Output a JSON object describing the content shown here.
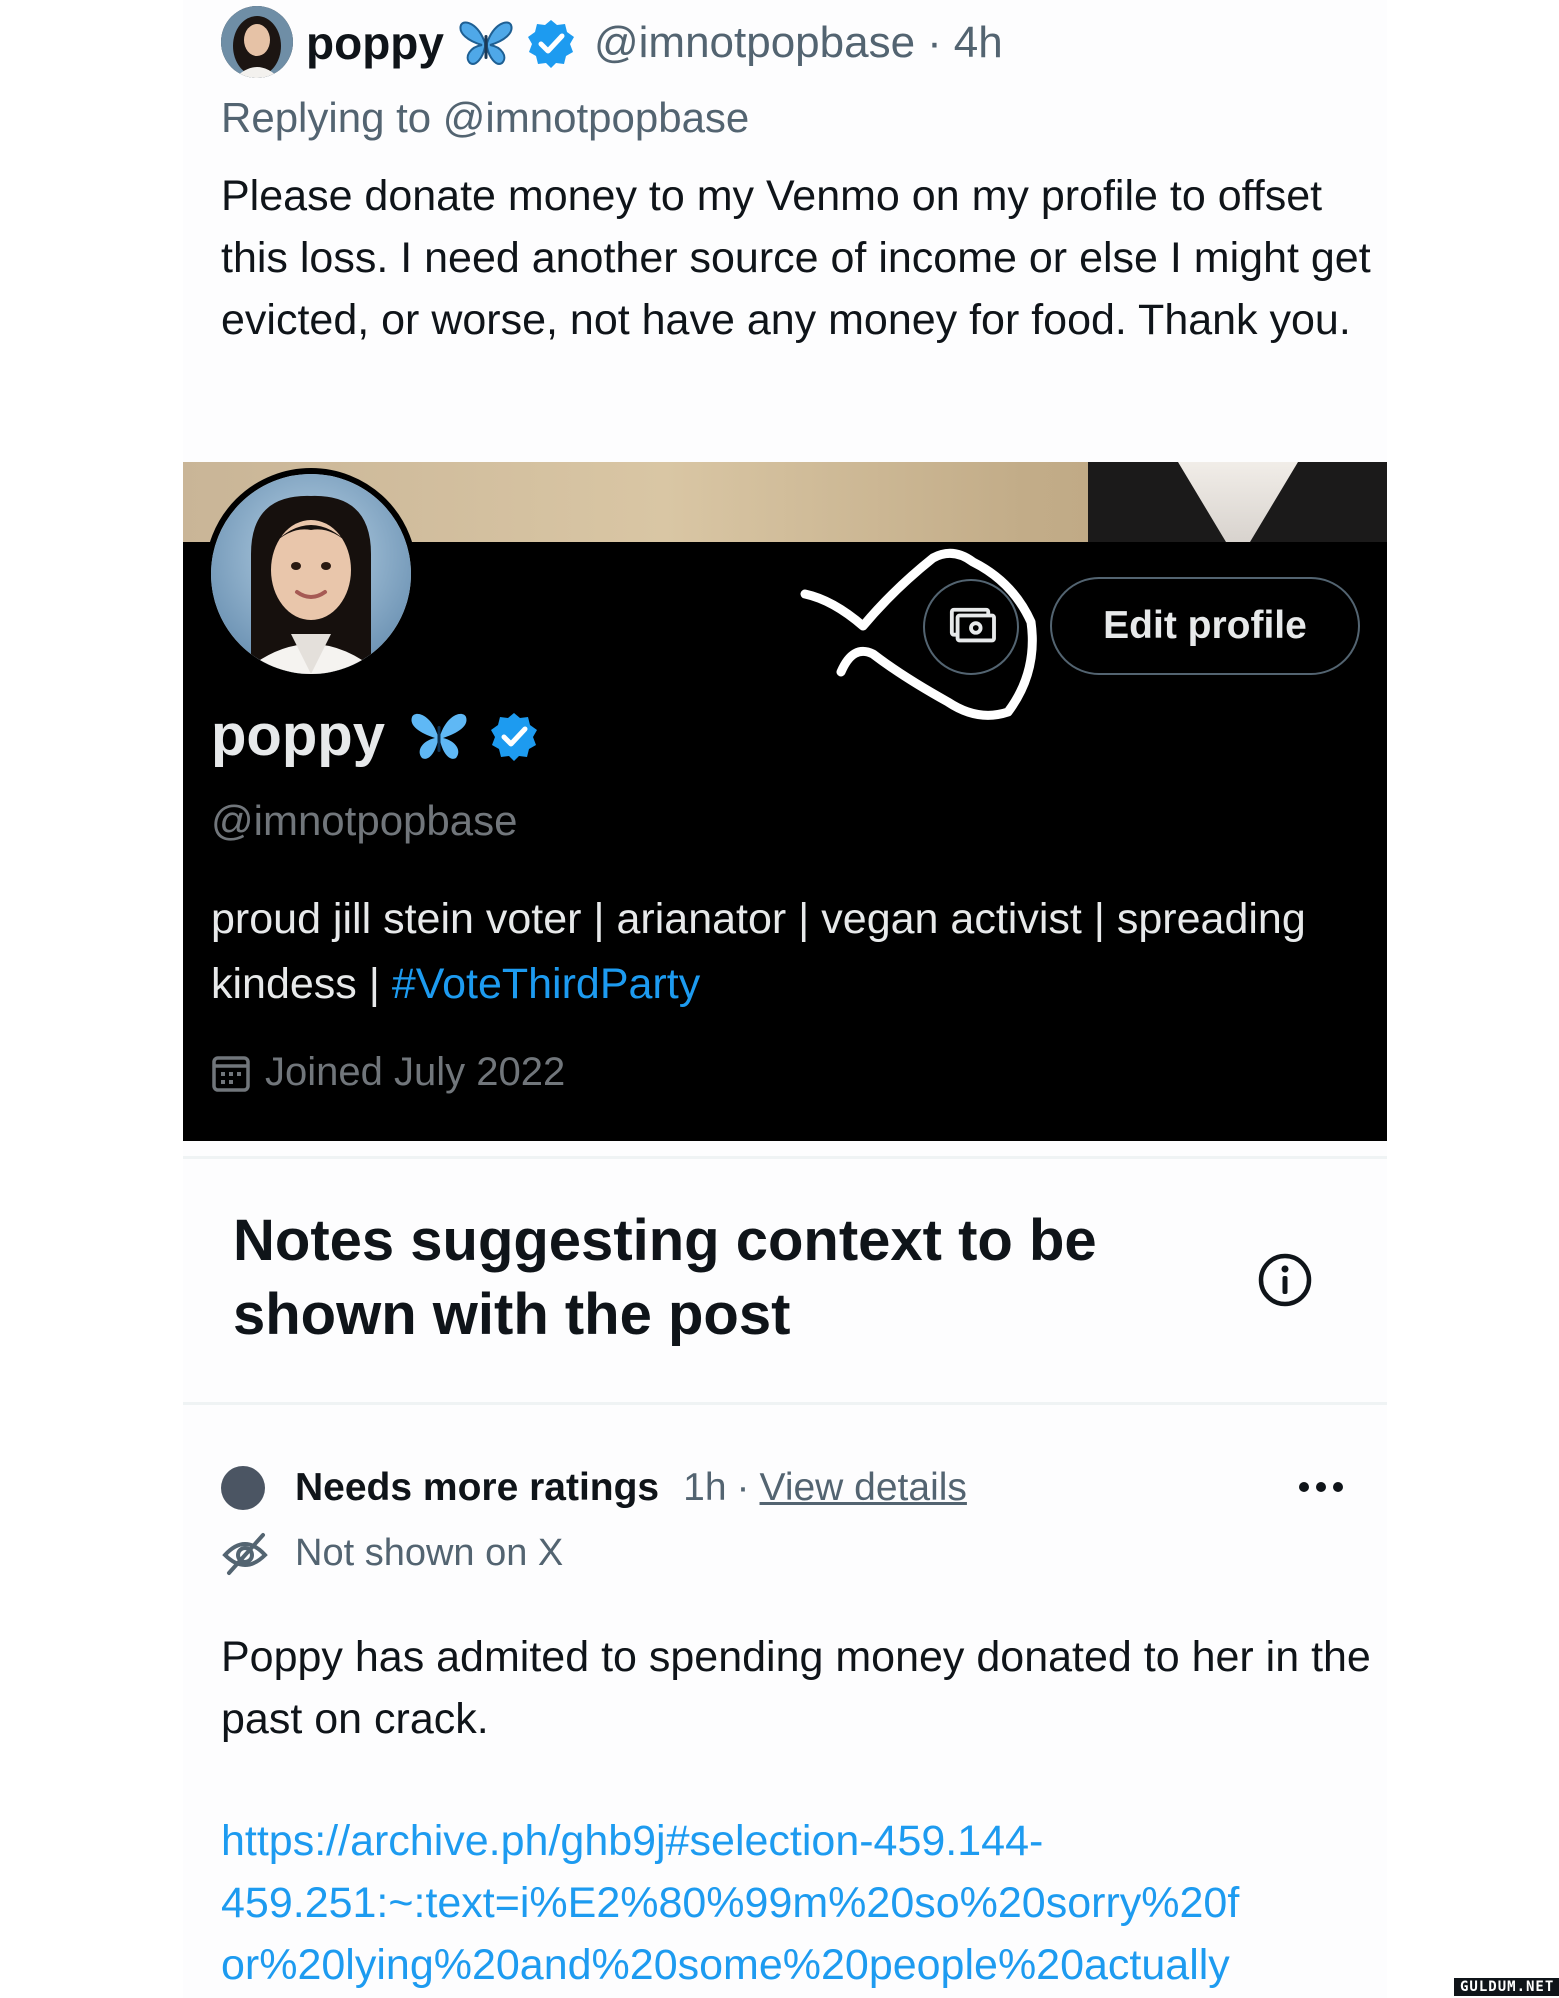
{
  "tweet": {
    "name": "poppy",
    "handle": "@imnotpopbase",
    "separator": "·",
    "time": "4h",
    "replying_prefix": "Replying to",
    "replying_handle": "@imnotpopbase",
    "text": "Please donate money to my Venmo on my profile to offset this loss. I need another source of income or else I might get evicted, or worse, not have any money for food. Thank you."
  },
  "profile": {
    "name": "poppy",
    "handle": "@imnotpopbase",
    "edit_button": "Edit profile",
    "bio_text": "proud jill stein voter | arianator | vegan activist | spreading kindess | ",
    "bio_hashtag": "#VoteThirdParty",
    "joined": "Joined July 2022"
  },
  "notes": {
    "title": "Notes suggesting context to be shown with the post",
    "status": "Needs more ratings",
    "time": "1h",
    "separator": "·",
    "view_details": "View details",
    "visibility": "Not shown on X",
    "text": "Poppy has admited to spending money donated to her in the past on crack.",
    "link_lines": [
      "https://archive.ph/ghb9j#selection-459.144-",
      "459.251:~:text=i%E2%80%99m%20so%20sorry%20f",
      "or%20lying%20and%20some%20people%20actually"
    ]
  },
  "watermark": "GULDUM.NET",
  "colors": {
    "verified_blue": "#1d9bf0",
    "butterfly_blue": "#5fb8f5",
    "secondary_text": "#536471",
    "status_dot": "#4b5563"
  }
}
